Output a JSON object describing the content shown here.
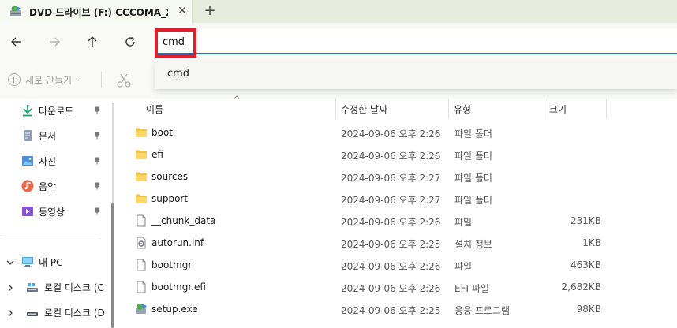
{
  "tab": {
    "title": "DVD 드라이브 (F:) CCCOMA_X",
    "close": "✕",
    "new": "+"
  },
  "address": {
    "value": "cmd",
    "placeholder": ""
  },
  "suggestion": {
    "item": "cmd"
  },
  "toolbar": {
    "new_label": "새로 만들기",
    "chevron": "⌵"
  },
  "sidebar": {
    "quick": [
      {
        "label": "다운로드",
        "icon": "download-icon"
      },
      {
        "label": "문서",
        "icon": "document-icon"
      },
      {
        "label": "사진",
        "icon": "picture-icon"
      },
      {
        "label": "음악",
        "icon": "music-icon"
      },
      {
        "label": "동영상",
        "icon": "video-icon"
      }
    ],
    "pc": {
      "label": "내 PC",
      "icon": "pc-icon"
    },
    "drives": [
      {
        "label": "로컬 디스크 (C"
      },
      {
        "label": "로컬 디스크 (D"
      }
    ]
  },
  "columns": {
    "name": "이름",
    "date": "수정한 날짜",
    "type": "유형",
    "size": "크기"
  },
  "files": [
    {
      "name": "boot",
      "date": "2024-09-06 오후 2:26",
      "type": "파일 폴더",
      "size": "",
      "kind": "folder"
    },
    {
      "name": "efi",
      "date": "2024-09-06 오후 2:26",
      "type": "파일 폴더",
      "size": "",
      "kind": "folder"
    },
    {
      "name": "sources",
      "date": "2024-09-06 오후 2:27",
      "type": "파일 폴더",
      "size": "",
      "kind": "folder"
    },
    {
      "name": "support",
      "date": "2024-09-06 오후 2:27",
      "type": "파일 폴더",
      "size": "",
      "kind": "folder"
    },
    {
      "name": "__chunk_data",
      "date": "2024-09-06 오후 2:26",
      "type": "파일",
      "size": "231KB",
      "kind": "file"
    },
    {
      "name": "autorun.inf",
      "date": "2024-09-06 오후 2:25",
      "type": "설치 정보",
      "size": "1KB",
      "kind": "setup"
    },
    {
      "name": "bootmgr",
      "date": "2024-09-06 오후 2:26",
      "type": "파일",
      "size": "463KB",
      "kind": "file"
    },
    {
      "name": "bootmgr.efi",
      "date": "2024-09-06 오후 2:26",
      "type": "EFI 파일",
      "size": "2,682KB",
      "kind": "file"
    },
    {
      "name": "setup.exe",
      "date": "2024-09-06 오후 2:25",
      "type": "응용 프로그램",
      "size": "98KB",
      "kind": "exe"
    }
  ],
  "colors": {
    "accent": "#1a73c8",
    "highlight": "#e0202a",
    "folder": "#f5c242"
  }
}
